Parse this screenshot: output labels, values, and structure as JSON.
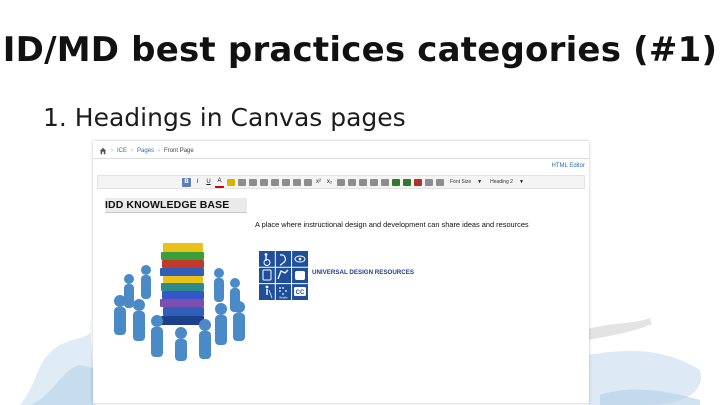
{
  "slide": {
    "title": "ID/MD best practices categories (#1)",
    "bullet": "1. Headings in Canvas pages"
  },
  "screenshot": {
    "breadcrumb": [
      "ICE",
      "Pages",
      "Front Page"
    ],
    "html_editor_link": "HTML Editor",
    "toolbar": {
      "bold": "B",
      "italic": "I",
      "underline": "U",
      "font_color": "A",
      "superscript": "x²",
      "subscript": "x₂",
      "font_size_select": "Font Size",
      "heading_select": "Heading 2"
    },
    "page": {
      "banner": "IDD KNOWLEDGE BASE",
      "tagline": "A place where instructional design and development can share ideas and resources",
      "ud_link": "UNIVERSAL DESIGN RESOURCES",
      "ud_small_text": "Braille",
      "ud_cc_text": "CC"
    }
  },
  "colors": {
    "accent_blue": "#2a6fb2",
    "link_navy": "#1f3e8f",
    "ud_icon_blue": "#1f4f9b",
    "people_blue": "#4a8ac6"
  }
}
